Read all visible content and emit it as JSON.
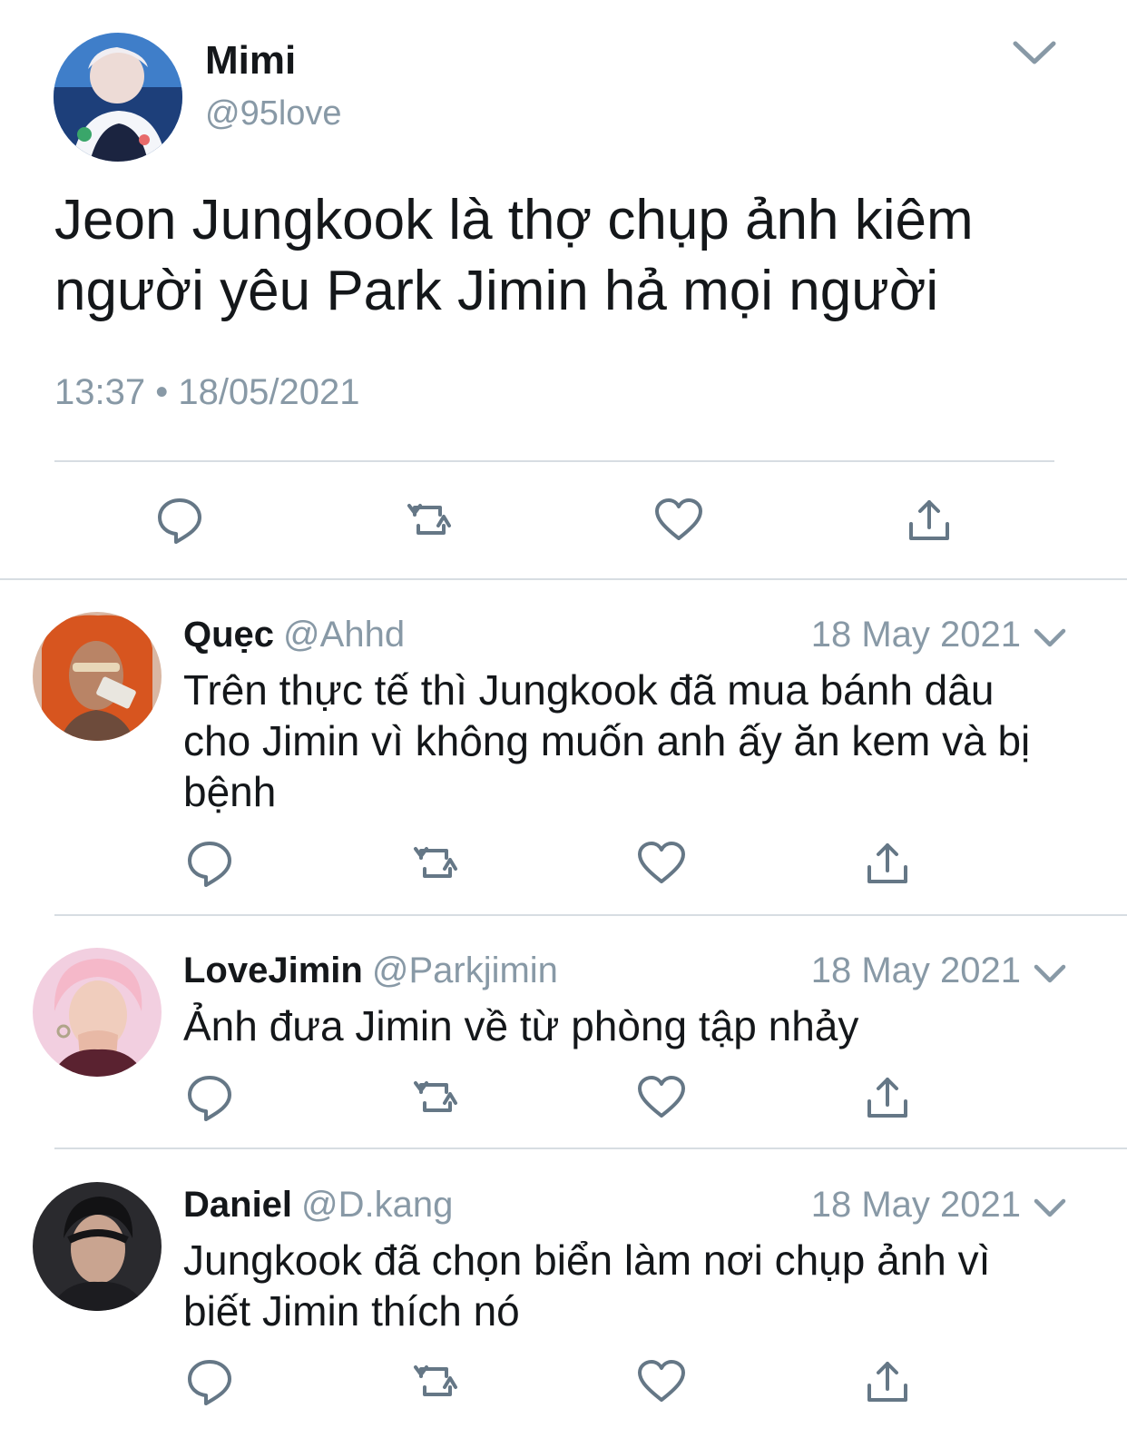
{
  "tweet": {
    "author_name": "Mimi",
    "author_handle": "@95love",
    "text": "Jeon Jungkook là thợ chụp ảnh kiêm người yêu Park Jimin hả mọi người",
    "time": "13:37 • 18/05/2021",
    "icons": [
      "reply-icon",
      "retweet-icon",
      "like-icon",
      "share-icon"
    ]
  },
  "replies": [
    {
      "name": "Quẹc",
      "handle": "@Ahhd",
      "date": "18 May 2021",
      "text": "Trên thực tế thì Jungkook đã mua bánh dâu cho Jimin vì không muốn anh ấy ăn kem và bị bệnh"
    },
    {
      "name": "LoveJimin",
      "handle": "@Parkjimin",
      "date": "18 May 2021",
      "text": "Ảnh đưa Jimin về từ phòng tập nhảy"
    },
    {
      "name": "Daniel",
      "handle": "@D.kang",
      "date": "18 May 2021",
      "text": "Jungkook đã chọn biển làm nơi chụp ảnh vì biết Jimin thích nó"
    }
  ],
  "colors": {
    "text": "#14171a",
    "secondary": "#8899a6",
    "icon": "#657786",
    "divider": "#d7dde2"
  }
}
